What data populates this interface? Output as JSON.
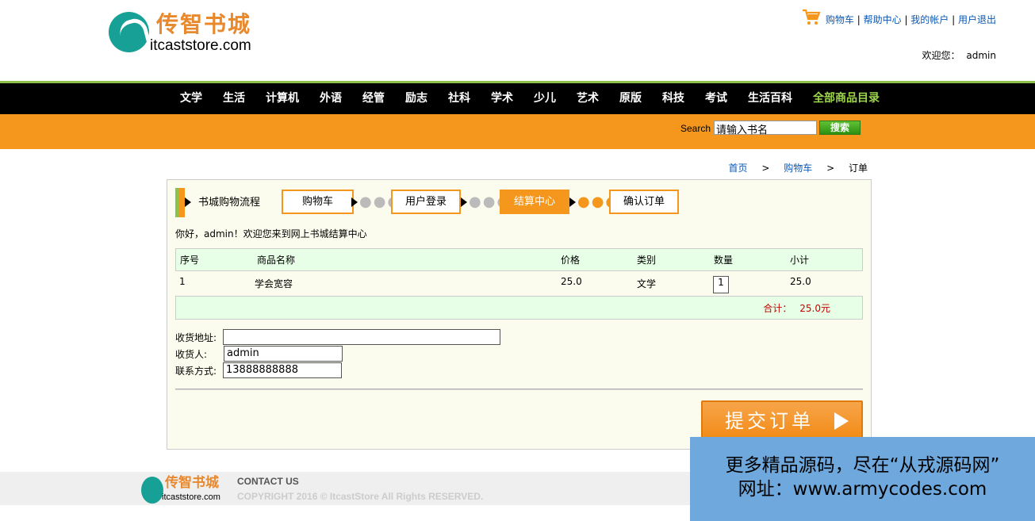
{
  "header": {
    "logo_cn": "传智书城",
    "logo_en": "itcaststore.com",
    "links": [
      "购物车",
      "帮助中心",
      "我的帐户",
      "用户退出"
    ],
    "welcome_label": "欢迎您：",
    "username": "admin"
  },
  "nav": {
    "items": [
      "文学",
      "生活",
      "计算机",
      "外语",
      "经管",
      "励志",
      "社科",
      "学术",
      "少儿",
      "艺术",
      "原版",
      "科技",
      "考试",
      "生活百科"
    ],
    "all_label": "全部商品目录"
  },
  "search": {
    "label": "Search",
    "value": "请输入书名",
    "button": "搜索"
  },
  "breadcrumb": {
    "home": "首页",
    "cart": "购物车",
    "current": "订单",
    "sep": ">"
  },
  "flow": {
    "title": "书城购物流程",
    "steps": [
      "购物车",
      "用户登录",
      "结算中心",
      "确认订单"
    ],
    "active_index": 2
  },
  "hello": "你好，admin！欢迎您来到网上书城结算中心",
  "order_table": {
    "headers": [
      "序号",
      "商品名称",
      "价格",
      "类别",
      "数量",
      "小计"
    ],
    "rows": [
      {
        "index": "1",
        "name": "学会宽容",
        "price": "25.0",
        "category": "文学",
        "quantity": "1",
        "subtotal": "25.0"
      }
    ],
    "total_label": "合计：",
    "total_value": "25.0元"
  },
  "form": {
    "address_label": "收货地址:",
    "address_value": "",
    "receiver_label": "收货人:",
    "receiver_value": "admin",
    "phone_label": "联系方式:",
    "phone_value": "13888888888"
  },
  "submit_label": "提交订单",
  "footer": {
    "logo_cn": "传智书城",
    "logo_en": "itcaststore.com",
    "contact": "CONTACT US",
    "copyright": "COPYRIGHT 2016 © ItcastStore All Rights RESERVED."
  },
  "watermark": {
    "line1": "更多精品源码，尽在“从戎源码网”",
    "line2": "网址：www.armycodes.com"
  },
  "colors": {
    "accent_orange": "#f5971c",
    "accent_green": "#8cc24a",
    "logo_teal": "#16a096",
    "link_blue": "#0c58b5"
  }
}
